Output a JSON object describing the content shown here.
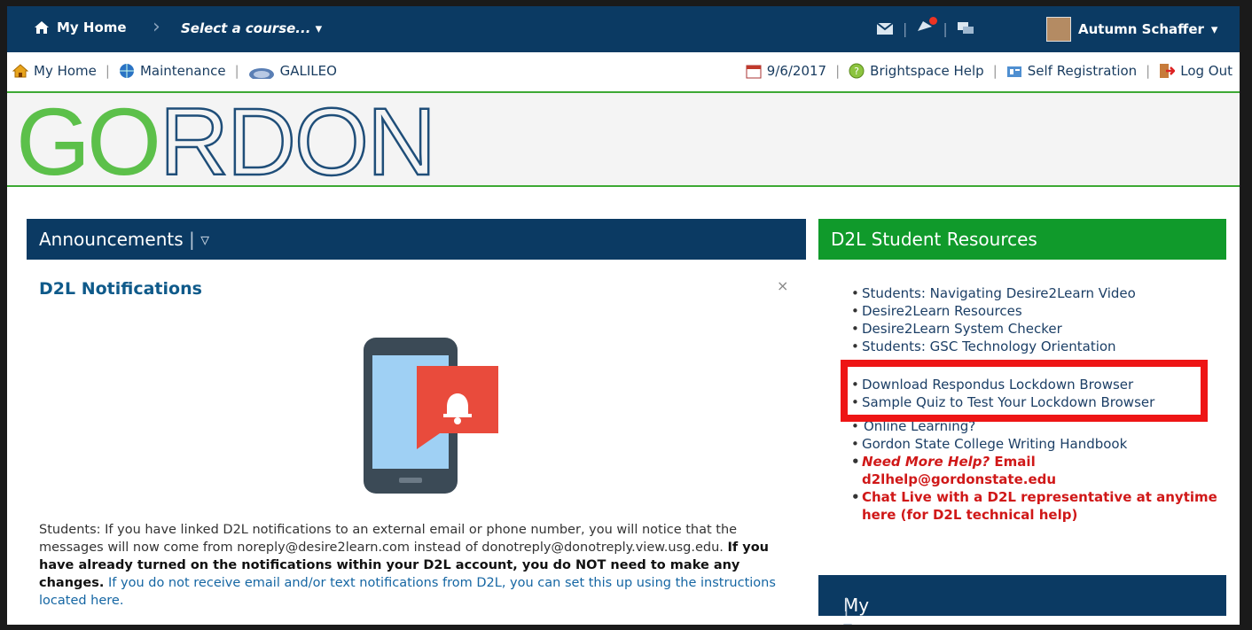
{
  "topnav": {
    "home_label": "My Home",
    "course_selector": "Select a course...",
    "user_name": "Autumn Schaffer"
  },
  "utilbar": {
    "home": "My Home",
    "maintenance": "Maintenance",
    "galileo": "GALILEO",
    "date": "9/6/2017",
    "help": "Brightspace Help",
    "self_registration": "Self Registration",
    "logout": "Log Out"
  },
  "banner": {
    "logo_text": "GORDON"
  },
  "announcements": {
    "header": "Announcements",
    "title": "D2L Notifications",
    "close": "×",
    "text_1": "Students: If you have linked D2L notifications to an external email or phone number, you will notice that the messages will now come from noreply@desire2learn.com instead of donotreply@donotreply.view.usg.edu.",
    "text_bold": "If you have already turned on the notifications within your D2L account, you do NOT need to make any changes.",
    "text_link": "If you do not receive email and/or text notifications from D2L, you can set this up using the instructions located here."
  },
  "resources": {
    "header": "D2L Student Resources",
    "items": [
      "Students: Navigating Desire2Learn Video",
      "Desire2Learn Resources",
      "Desire2Learn System Checker",
      "Students: GSC Technology Orientation"
    ],
    "boxed": [
      "Download Respondus Lockdown Browser",
      "Sample Quiz to Test Your Lockdown Browser"
    ],
    "after": [
      "Online Learning?",
      "Gordon State College Writing Handbook"
    ],
    "help_italic": "Need More Help?",
    "help_rest": " Email d2lhelp@gordonstate.edu",
    "chat": "Chat Live with a D2L representative at anytime here (for D2L technical help)"
  },
  "courses": {
    "header": "My Courses"
  },
  "colors": {
    "navy": "#0b3a63",
    "green": "#109a2b",
    "logo_green": "#5cc04a",
    "logo_blue": "#1f4e79",
    "highlight": "#ee1515"
  }
}
